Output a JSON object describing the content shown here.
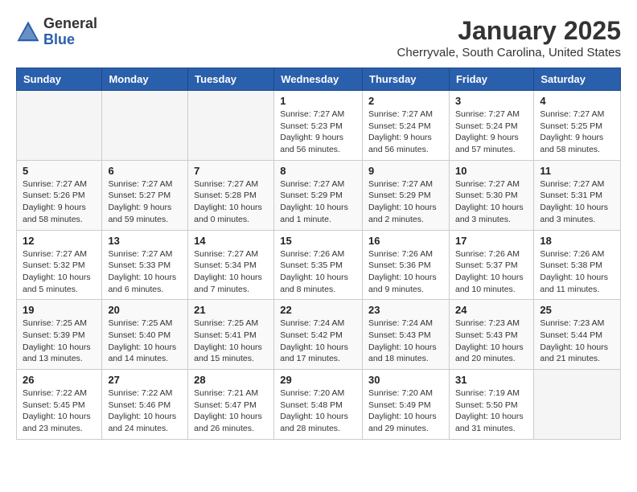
{
  "header": {
    "logo_general": "General",
    "logo_blue": "Blue",
    "title": "January 2025",
    "subtitle": "Cherryvale, South Carolina, United States"
  },
  "weekdays": [
    "Sunday",
    "Monday",
    "Tuesday",
    "Wednesday",
    "Thursday",
    "Friday",
    "Saturday"
  ],
  "weeks": [
    [
      {
        "day": "",
        "info": ""
      },
      {
        "day": "",
        "info": ""
      },
      {
        "day": "",
        "info": ""
      },
      {
        "day": "1",
        "info": "Sunrise: 7:27 AM\nSunset: 5:23 PM\nDaylight: 9 hours\nand 56 minutes."
      },
      {
        "day": "2",
        "info": "Sunrise: 7:27 AM\nSunset: 5:24 PM\nDaylight: 9 hours\nand 56 minutes."
      },
      {
        "day": "3",
        "info": "Sunrise: 7:27 AM\nSunset: 5:24 PM\nDaylight: 9 hours\nand 57 minutes."
      },
      {
        "day": "4",
        "info": "Sunrise: 7:27 AM\nSunset: 5:25 PM\nDaylight: 9 hours\nand 58 minutes."
      }
    ],
    [
      {
        "day": "5",
        "info": "Sunrise: 7:27 AM\nSunset: 5:26 PM\nDaylight: 9 hours\nand 58 minutes."
      },
      {
        "day": "6",
        "info": "Sunrise: 7:27 AM\nSunset: 5:27 PM\nDaylight: 9 hours\nand 59 minutes."
      },
      {
        "day": "7",
        "info": "Sunrise: 7:27 AM\nSunset: 5:28 PM\nDaylight: 10 hours\nand 0 minutes."
      },
      {
        "day": "8",
        "info": "Sunrise: 7:27 AM\nSunset: 5:29 PM\nDaylight: 10 hours\nand 1 minute."
      },
      {
        "day": "9",
        "info": "Sunrise: 7:27 AM\nSunset: 5:29 PM\nDaylight: 10 hours\nand 2 minutes."
      },
      {
        "day": "10",
        "info": "Sunrise: 7:27 AM\nSunset: 5:30 PM\nDaylight: 10 hours\nand 3 minutes."
      },
      {
        "day": "11",
        "info": "Sunrise: 7:27 AM\nSunset: 5:31 PM\nDaylight: 10 hours\nand 3 minutes."
      }
    ],
    [
      {
        "day": "12",
        "info": "Sunrise: 7:27 AM\nSunset: 5:32 PM\nDaylight: 10 hours\nand 5 minutes."
      },
      {
        "day": "13",
        "info": "Sunrise: 7:27 AM\nSunset: 5:33 PM\nDaylight: 10 hours\nand 6 minutes."
      },
      {
        "day": "14",
        "info": "Sunrise: 7:27 AM\nSunset: 5:34 PM\nDaylight: 10 hours\nand 7 minutes."
      },
      {
        "day": "15",
        "info": "Sunrise: 7:26 AM\nSunset: 5:35 PM\nDaylight: 10 hours\nand 8 minutes."
      },
      {
        "day": "16",
        "info": "Sunrise: 7:26 AM\nSunset: 5:36 PM\nDaylight: 10 hours\nand 9 minutes."
      },
      {
        "day": "17",
        "info": "Sunrise: 7:26 AM\nSunset: 5:37 PM\nDaylight: 10 hours\nand 10 minutes."
      },
      {
        "day": "18",
        "info": "Sunrise: 7:26 AM\nSunset: 5:38 PM\nDaylight: 10 hours\nand 11 minutes."
      }
    ],
    [
      {
        "day": "19",
        "info": "Sunrise: 7:25 AM\nSunset: 5:39 PM\nDaylight: 10 hours\nand 13 minutes."
      },
      {
        "day": "20",
        "info": "Sunrise: 7:25 AM\nSunset: 5:40 PM\nDaylight: 10 hours\nand 14 minutes."
      },
      {
        "day": "21",
        "info": "Sunrise: 7:25 AM\nSunset: 5:41 PM\nDaylight: 10 hours\nand 15 minutes."
      },
      {
        "day": "22",
        "info": "Sunrise: 7:24 AM\nSunset: 5:42 PM\nDaylight: 10 hours\nand 17 minutes."
      },
      {
        "day": "23",
        "info": "Sunrise: 7:24 AM\nSunset: 5:43 PM\nDaylight: 10 hours\nand 18 minutes."
      },
      {
        "day": "24",
        "info": "Sunrise: 7:23 AM\nSunset: 5:43 PM\nDaylight: 10 hours\nand 20 minutes."
      },
      {
        "day": "25",
        "info": "Sunrise: 7:23 AM\nSunset: 5:44 PM\nDaylight: 10 hours\nand 21 minutes."
      }
    ],
    [
      {
        "day": "26",
        "info": "Sunrise: 7:22 AM\nSunset: 5:45 PM\nDaylight: 10 hours\nand 23 minutes."
      },
      {
        "day": "27",
        "info": "Sunrise: 7:22 AM\nSunset: 5:46 PM\nDaylight: 10 hours\nand 24 minutes."
      },
      {
        "day": "28",
        "info": "Sunrise: 7:21 AM\nSunset: 5:47 PM\nDaylight: 10 hours\nand 26 minutes."
      },
      {
        "day": "29",
        "info": "Sunrise: 7:20 AM\nSunset: 5:48 PM\nDaylight: 10 hours\nand 28 minutes."
      },
      {
        "day": "30",
        "info": "Sunrise: 7:20 AM\nSunset: 5:49 PM\nDaylight: 10 hours\nand 29 minutes."
      },
      {
        "day": "31",
        "info": "Sunrise: 7:19 AM\nSunset: 5:50 PM\nDaylight: 10 hours\nand 31 minutes."
      },
      {
        "day": "",
        "info": ""
      }
    ]
  ]
}
